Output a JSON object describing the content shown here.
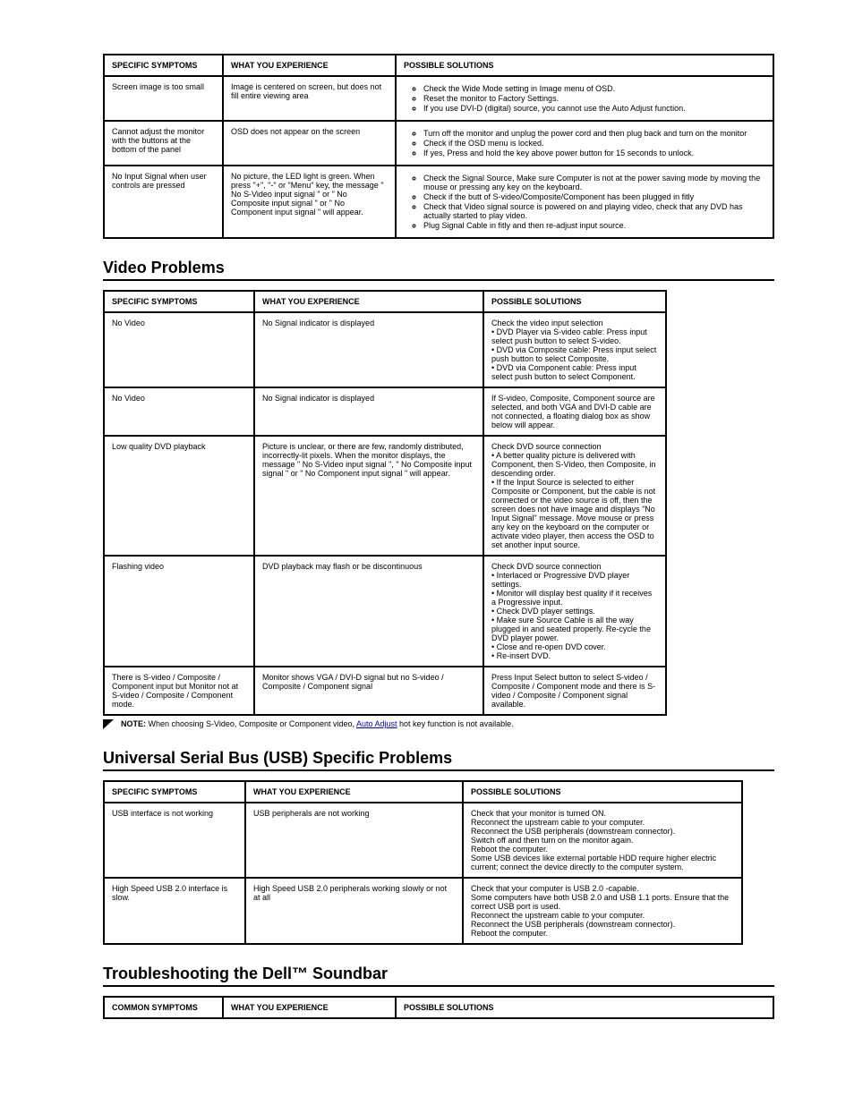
{
  "tableA": {
    "headers": [
      "SPECIFIC SYMPTOMS",
      "WHAT YOU EXPERIENCE",
      "POSSIBLE SOLUTIONS"
    ],
    "rows": [
      {
        "c0": "Screen image is too small",
        "c1": "Image is centered on screen, but does not fill entire viewing area",
        "items": [
          "Check the Wide Mode setting in Image menu of OSD.",
          "Reset the monitor to Factory Settings.",
          "If you use DVI-D (digital) source, you cannot use  the Auto Adjust function."
        ]
      },
      {
        "c0": "Cannot adjust the monitor with the buttons at the bottom of the panel",
        "c1": "OSD does not appear on the screen",
        "items": [
          "Turn off the monitor and unplug the power cord and then plug back and turn on the monitor",
          "Check if the OSD menu is locked.",
          "If yes, Press and hold the key  above power button for 15 seconds to unlock."
        ]
      },
      {
        "c0": "No Input Signal when user controls are pressed",
        "c1": "No picture, the LED light is green. When press \"+\", \"-\" or \"Menu\" key, the message \" No S-Video input signal \" or \" No Composite input signal \" or \" No Component input signal \"  will appear.",
        "items": [
          "Check the Signal Source, Make sure Computer is not at the power saving mode by moving the mouse or pressing any key on the keyboard.",
          "Check if the butt of S-video/Composite/Component has been plugged in fitly",
          "Check that Video signal source is powered on and playing video, check that any DVD has actually started to play video.",
          "Plug Signal Cable in fitly and then re-adjust input source."
        ]
      }
    ]
  },
  "sectionVideoTitle": "Video Problems",
  "tableV": {
    "headers": [
      "SPECIFIC SYMPTOMS",
      "WHAT YOU EXPERIENCE",
      "POSSIBLE SOLUTIONS"
    ],
    "rows": [
      {
        "c0": "No Video",
        "c1": "No Signal indicator is displayed",
        "c2": "Check the video input selection\n• DVD Player via S-video cable: Press input select push button to select S-video.\n• DVD via Composite cable: Press input select push button to select Composite.\n• DVD via Component cable: Press input select push button to select Component."
      },
      {
        "c0": "No Video",
        "c1": "No Signal indicator is displayed",
        "c2": "If S-video, Composite, Component source are selected, and both VGA and DVI-D cable are not connected, a floating dialog box as show below will appear."
      },
      {
        "c0": "Low quality DVD playback",
        "c1": "Picture is unclear, or there are few, randomly distributed, incorrectly-lit pixels. When the monitor displays, the message \" No S-Video input signal \", \" No Composite input signal \"  or \" No Component input signal \"  will appear.",
        "c2": "Check DVD source connection\n• A better quality picture is delivered with Component, then S-Video, then Composite, in descending order.\n• If the Input Source is selected to either Composite or Component, but the cable is not connected or the video source is off, then the screen does not have image and displays \"No Input Signal\" message.  Move mouse or press any key on the keyboard on the computer or  activate video player,  then access the OSD to set another input source."
      },
      {
        "c0": "Flashing video",
        "c1": "DVD playback may flash or be discontinuous",
        "c2lines": [
          "Check DVD source connection",
          "• Interlaced or Progressive DVD player settings.",
          "• Monitor will display best quality if it receives a Progressive input.",
          "• Check DVD player settings.",
          "• Make sure Source Cable is all the way plugged in and seated properly.  Re-cycle the DVD player power.",
          "• Close and re-open DVD cover.",
          "• Re-insert DVD."
        ]
      },
      {
        "c0": "There is S-video / Composite / Component input but Monitor not at S-video / Composite / Component mode.",
        "c1": "Monitor shows VGA / DVI-D signal but no S-video / Composite / Component  signal",
        "c2": "Press Input Select button to select S-video / Composite / Component mode and there is S-video / Composite / Component  signal available."
      }
    ],
    "note_prefix": "NOTE:",
    "note_text_a": "When choosing S-Video, Composite or Component video, ",
    "note_link": "Auto Adjust",
    "note_text_b": "  hot key function is not available."
  },
  "sectionUSBTitle": "Universal Serial Bus (USB) Specific Problems",
  "tableU": {
    "headers": [
      "SPECIFIC SYMPTOMS",
      "WHAT YOU EXPERIENCE",
      "POSSIBLE SOLUTIONS"
    ],
    "rows": [
      {
        "c0": "USB interface is not working",
        "c1": "USB peripherals are not working",
        "c2lines": [
          "Check that your monitor is turned ON.",
          "Reconnect the upstream cable to your computer.",
          "Reconnect the USB peripherals (downstream connector).",
          "Switch off and then turn on the monitor again.",
          "Reboot the computer.",
          "Some USB devices like external portable HDD require higher electric current; connect the device directly to the computer system."
        ]
      },
      {
        "c0": "High Speed USB 2.0 interface is slow.",
        "c1": "High Speed USB 2.0 peripherals working slowly or not at all",
        "c2lines": [
          "Check that your computer is USB 2.0 -capable.",
          "Some computers have both USB 2.0 and USB 1.1 ports. Ensure that the correct USB port is used.",
          "Reconnect the upstream cable to your computer.",
          "Reconnect the USB peripherals (downstream connector).",
          "Reboot the computer."
        ]
      }
    ]
  },
  "sectionSBTitle": "Troubleshooting the Dell™ Soundbar",
  "tableSB": {
    "headers": [
      "COMMON SYMPTOMS",
      "WHAT YOU EXPERIENCE",
      "POSSIBLE SOLUTIONS"
    ]
  }
}
